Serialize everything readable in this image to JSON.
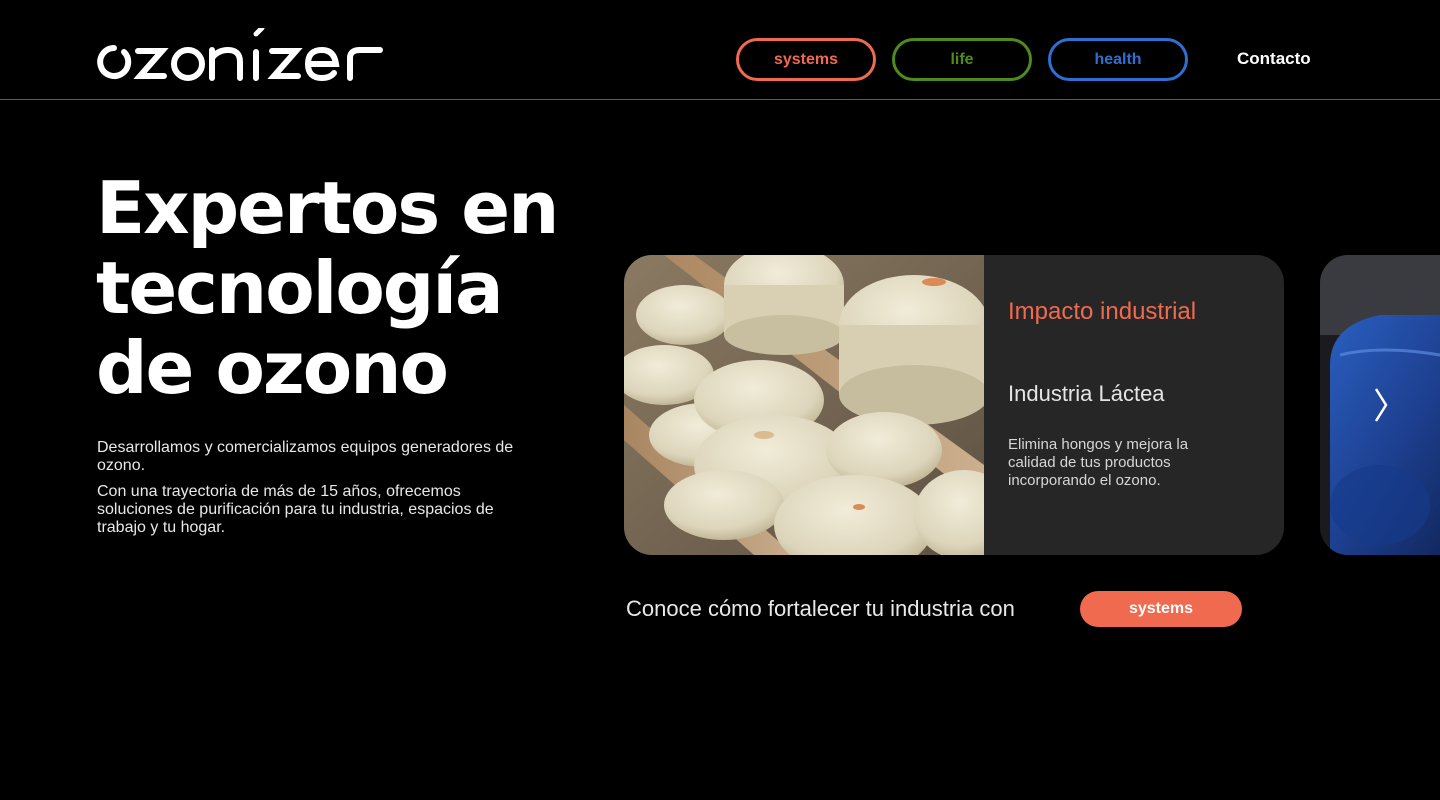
{
  "brand": {
    "logo_text": "ozonizer"
  },
  "nav": {
    "systems": "systems",
    "life": "life",
    "health": "health",
    "contact": "Contacto"
  },
  "colors": {
    "systems": "#f06a4f",
    "life": "#4f8a1f",
    "health": "#2f6fd1",
    "card_bg": "#262626",
    "accent": "#f06a4f"
  },
  "hero": {
    "title_line1": "Expertos en",
    "title_line2": "tecnología",
    "title_line3": "de ozono",
    "paragraph1": "Desarrollamos y comercializamos equipos generadores de ozono.",
    "paragraph2": "Con una trayectoria de más de 15 años, ofrecemos soluciones de purificación para tu industria, espacios de trabajo y tu hogar."
  },
  "carousel": {
    "card": {
      "eyebrow": "Impacto industrial",
      "title": "Industria Láctea",
      "description": "Elimina hongos y mejora la calidad de tus productos incorporando el ozono."
    },
    "next_icon": "chevron-right-icon"
  },
  "cta": {
    "text": "Conoce cómo fortalecer tu industria con",
    "button": "systems"
  }
}
